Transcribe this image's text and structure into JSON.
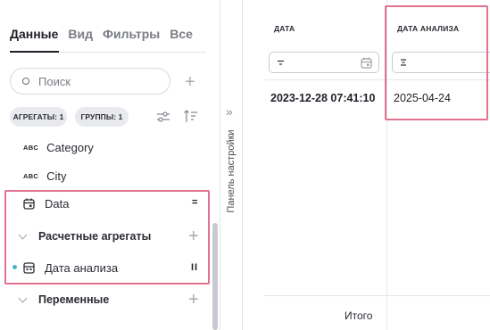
{
  "tabs": [
    {
      "label": "Данные",
      "active": true
    },
    {
      "label": "Вид",
      "active": false
    },
    {
      "label": "Фильтры",
      "active": false
    },
    {
      "label": "Все",
      "active": false
    }
  ],
  "search": {
    "placeholder": "Поиск",
    "value": ""
  },
  "chips": {
    "aggregates": "АГРЕГАТЫ: 1",
    "groups": "ГРУППЫ: 1"
  },
  "fields": [
    {
      "type_label": "ABC",
      "name": "Category"
    },
    {
      "type_label": "ABC",
      "name": "City"
    }
  ],
  "date_field": {
    "name": "Data",
    "handle": "="
  },
  "computed_group": {
    "label": "Расчетные агрегаты"
  },
  "computed_field": {
    "name": "Дата анализа",
    "handle": "II"
  },
  "variables_group": {
    "label": "Переменные"
  },
  "collapsed_panel": {
    "label": "Панель настройки",
    "arrow": "»"
  },
  "table": {
    "columns": [
      {
        "header": "ДАТА",
        "filter_icon": "sort-icon",
        "filter_extra_icon": "calendar-icon"
      },
      {
        "header": "ДАТА АНАЛИЗА",
        "filter_icon": "sigma-icon"
      }
    ],
    "rows": [
      [
        "2023-12-28 07:41:10",
        "2025-04-24"
      ]
    ],
    "total_label": "Итого"
  },
  "colors": {
    "highlight": "#e0728f",
    "accent_dot": "#4ab3c9"
  }
}
